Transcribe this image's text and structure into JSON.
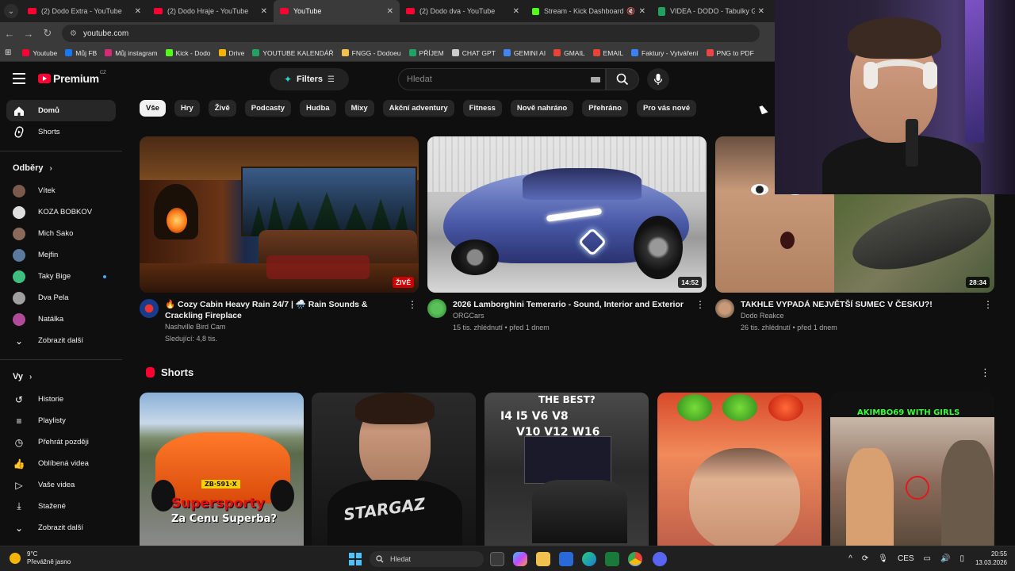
{
  "browser": {
    "tabs": [
      {
        "title": "(2) Dodo Extra - YouTube",
        "icon": "youtube-icon",
        "active": false
      },
      {
        "title": "(2) Dodo Hraje - YouTube",
        "icon": "youtube-icon",
        "active": false
      },
      {
        "title": "YouTube",
        "icon": "youtube-icon",
        "active": true
      },
      {
        "title": "(2) Dodo dva - YouTube",
        "icon": "youtube-icon",
        "active": false
      },
      {
        "title": "Stream - Kick Dashboard",
        "icon": "kick-icon",
        "active": false
      },
      {
        "title": "VIDEA - DODO - Tabulky Googl",
        "icon": "sheets-icon",
        "active": false
      }
    ],
    "url": "youtube.com",
    "bookmarks": [
      {
        "label": "Youtube",
        "color": "#ff0033"
      },
      {
        "label": "Můj FB",
        "color": "#1877f2"
      },
      {
        "label": "Můj instagram",
        "color": "#d62976"
      },
      {
        "label": "Kick - Dodo",
        "color": "#53fc18"
      },
      {
        "label": "Drive",
        "color": "#f4b400"
      },
      {
        "label": "YOUTUBE KALENDÁŘ",
        "color": "#1ea362"
      },
      {
        "label": "FNGG - Dodoeu",
        "color": "#f2c14e"
      },
      {
        "label": "PŘÍJEM",
        "color": "#1ea362"
      },
      {
        "label": "CHAT GPT",
        "color": "#cccccc"
      },
      {
        "label": "GEMINI AI",
        "color": "#4285f4"
      },
      {
        "label": "GMAIL",
        "color": "#ea4335"
      },
      {
        "label": "EMAIL",
        "color": "#ea4335"
      },
      {
        "label": "Faktury - Vytváření",
        "color": "#3b82f6"
      },
      {
        "label": "PNG to PDF",
        "color": "#ef4444"
      }
    ]
  },
  "youtube": {
    "logo_text": "Premium",
    "country_code": "CZ",
    "filters_label": "Filters",
    "search_placeholder": "Hledat",
    "chips": [
      "Vše",
      "Hry",
      "Živě",
      "Podcasty",
      "Hudba",
      "Mixy",
      "Akční adventury",
      "Fitness",
      "Nově nahráno",
      "Přehráno",
      "Pro vás nové"
    ],
    "sidebar": {
      "main": [
        {
          "label": "Domů",
          "icon": "home-icon"
        },
        {
          "label": "Shorts",
          "icon": "shorts-icon"
        }
      ],
      "subs_heading": "Odběry",
      "subs": [
        {
          "label": "Vítek",
          "color": "#7a5a4a"
        },
        {
          "label": "KOZA BOBKOV",
          "color": "#dddddd"
        },
        {
          "label": "Mich Sako",
          "color": "#8a6a5a"
        },
        {
          "label": "Mejfin",
          "color": "#5a7aa0"
        },
        {
          "label": "Taky Bige",
          "color": "#3fbf7f"
        },
        {
          "label": "Dva Pela",
          "color": "#a0a0a0"
        },
        {
          "label": "Natálka",
          "color": "#b04a9a"
        }
      ],
      "subs_more": "Zobrazit další",
      "you_heading": "Vy",
      "you": [
        {
          "label": "Historie",
          "icon": "history-icon"
        },
        {
          "label": "Playlisty",
          "icon": "playlist-icon"
        },
        {
          "label": "Přehrát později",
          "icon": "clock-icon"
        },
        {
          "label": "Oblíbená videa",
          "icon": "like-icon"
        },
        {
          "label": "Vaše videa",
          "icon": "video-icon"
        },
        {
          "label": "Stažené",
          "icon": "download-icon"
        },
        {
          "label": "Zobrazit další",
          "icon": "chevron-down-icon"
        }
      ]
    },
    "videos": [
      {
        "title": "🔥 Cozy Cabin Heavy Rain 24/7 | 🌧️ Rain Sounds & Crackling Fireplace",
        "channel": "Nashville Bird Cam",
        "stats": "Sledující: 4,8 tis.",
        "badge": "ŽIVĚ",
        "badge_type": "live"
      },
      {
        "title": "2026 Lamborghini Temerario - Sound, Interior and Exterior",
        "channel": "ORGCars",
        "stats": "15 tis. zhlédnutí • před 1 dnem",
        "badge": "14:52",
        "badge_type": "duration"
      },
      {
        "title": "TAKHLE VYPADÁ NEJVĚTŠÍ SUMEC V ČESKU?!",
        "channel": "Dodo Reakce",
        "stats": "26 tis. zhlédnutí • před 1 dnem",
        "badge": "28:34",
        "badge_type": "duration"
      }
    ],
    "shorts_heading": "Shorts",
    "shorts": [
      {
        "top_text": "",
        "bottom_text": "Supersporty",
        "bottom_text2": "Za Cenu Superba?",
        "plate": "ZB·591·X"
      },
      {
        "top_text": "",
        "bottom_text": "STARGAZ",
        "bottom_text2": "",
        "plate": ""
      },
      {
        "top_text": "THE BEST?",
        "bottom_text": "I4  I5  V6  V8",
        "bottom_text2": "V10  V12  W16",
        "plate": ""
      },
      {
        "top_text": "",
        "bottom_text": "",
        "bottom_text2": "",
        "plate": ""
      },
      {
        "top_text": "AKIMBO69 WITH GIRLS",
        "bottom_text": "",
        "bottom_text2": "",
        "plate": ""
      }
    ]
  },
  "taskbar": {
    "weather_temp": "9°C",
    "weather_desc": "Převážně jasno",
    "search_label": "Hledat",
    "lang": "CES",
    "time": "20:55",
    "date": "13.03.2026"
  }
}
